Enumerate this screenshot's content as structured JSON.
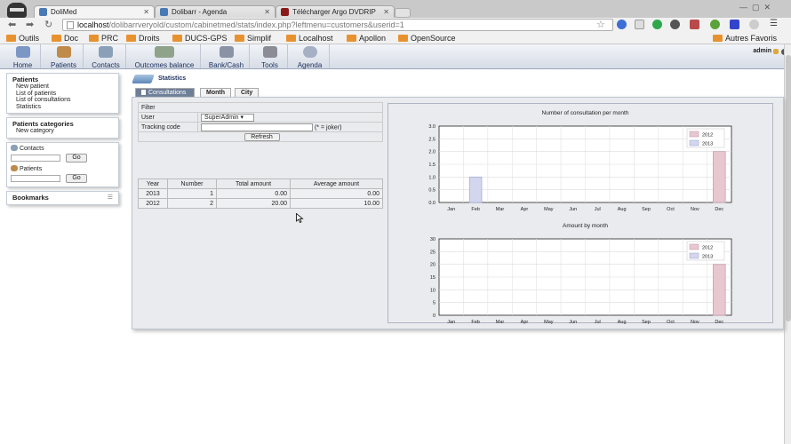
{
  "browser": {
    "tabs": [
      {
        "title": "DoliMed",
        "favicon_color": "#4a7ab5",
        "active": true
      },
      {
        "title": "Dolibarr - Agenda",
        "favicon_color": "#4a7ab5",
        "active": false
      },
      {
        "title": "Télécharger Argo DVDRIP",
        "favicon_color": "#8a1a1a",
        "active": false
      }
    ],
    "url_host": "localhost",
    "url_path": "/dolibarrveryold/custom/cabinetmed/stats/index.php?leftmenu=customers&userid=1",
    "bookmarks": [
      "Outils",
      "Doc",
      "PRC",
      "Droits",
      "DUCS-GPS",
      "Simplif",
      "Localhost",
      "Apollon",
      "OpenSource"
    ],
    "other_bookmarks": "Autres Favoris"
  },
  "topmenu": {
    "items": [
      {
        "label": "Home",
        "icon": "home-icon",
        "color": "#7d97c4"
      },
      {
        "label": "Patients",
        "icon": "patients-icon",
        "color": "#c08a4a"
      },
      {
        "label": "Contacts",
        "icon": "stethoscope-icon",
        "color": "#8aa0b8"
      },
      {
        "label": "Outcomes balance",
        "icon": "money-icon",
        "color": "#8fa38a"
      },
      {
        "label": "Bank/Cash",
        "icon": "bank-icon",
        "color": "#8a93a6"
      },
      {
        "label": "Tools",
        "icon": "tools-icon",
        "color": "#8c8c96"
      },
      {
        "label": "Agenda",
        "icon": "clock-icon",
        "color": "#a6b0c4"
      }
    ],
    "user": "admin"
  },
  "left": {
    "patients_title": "Patients",
    "patients_links": [
      "New patient",
      "List of patients",
      "List of consultations",
      "Statistics"
    ],
    "categories_title": "Patients categories",
    "categories_links": [
      "New category"
    ],
    "contacts_label": "Contacts",
    "patients_label": "Patients",
    "go_label": "Go",
    "bookmarks_title": "Bookmarks"
  },
  "main": {
    "title": "Statistics",
    "tabs": [
      "Consultations",
      "Month",
      "City"
    ],
    "filter": {
      "title": "Filter",
      "user_label": "User",
      "user_value": "SuperAdmin",
      "tracking_label": "Tracking code",
      "tracking_value": "",
      "joker_hint": "(* = joker)",
      "refresh_label": "Refresh"
    },
    "table": {
      "headers": [
        "Year",
        "Number",
        "Total amount",
        "Average amount"
      ],
      "rows": [
        [
          "2013",
          "1",
          "0.00",
          "0.00"
        ],
        [
          "2012",
          "2",
          "20.00",
          "10.00"
        ]
      ]
    }
  },
  "chart_data": [
    {
      "type": "bar",
      "title": "Number of consultation per month",
      "categories": [
        "Jan",
        "Feb",
        "Mar",
        "Apr",
        "May",
        "Jun",
        "Jul",
        "Aug",
        "Sep",
        "Oct",
        "Nov",
        "Dec"
      ],
      "series": [
        {
          "name": "2012",
          "color": "#e8c7d0",
          "stroke": "#c9a0ad",
          "values": [
            0,
            0,
            0,
            0,
            0,
            0,
            0,
            0,
            0,
            0,
            0,
            2
          ]
        },
        {
          "name": "2013",
          "color": "#d3d6ee",
          "stroke": "#a9aed6",
          "values": [
            0,
            1,
            0,
            0,
            0,
            0,
            0,
            0,
            0,
            0,
            0,
            0
          ]
        }
      ],
      "yticks": [
        "0.0",
        "0.5",
        "1.0",
        "1.5",
        "2.0",
        "2.5",
        "3.0"
      ],
      "ylim": [
        0,
        3
      ]
    },
    {
      "type": "bar",
      "title": "Amount by month",
      "categories": [
        "Jan",
        "Feb",
        "Mar",
        "Apr",
        "May",
        "Jun",
        "Jul",
        "Aug",
        "Sep",
        "Oct",
        "Nov",
        "Dec"
      ],
      "series": [
        {
          "name": "2012",
          "color": "#e8c7d0",
          "stroke": "#c9a0ad",
          "values": [
            0,
            0,
            0,
            0,
            0,
            0,
            0,
            0,
            0,
            0,
            0,
            20
          ]
        },
        {
          "name": "2013",
          "color": "#d3d6ee",
          "stroke": "#a9aed6",
          "values": [
            0,
            0,
            0,
            0,
            0,
            0,
            0,
            0,
            0,
            0,
            0,
            0
          ]
        }
      ],
      "yticks": [
        "0",
        "5",
        "10",
        "15",
        "20",
        "25",
        "30"
      ],
      "ylim": [
        0,
        30
      ]
    }
  ]
}
